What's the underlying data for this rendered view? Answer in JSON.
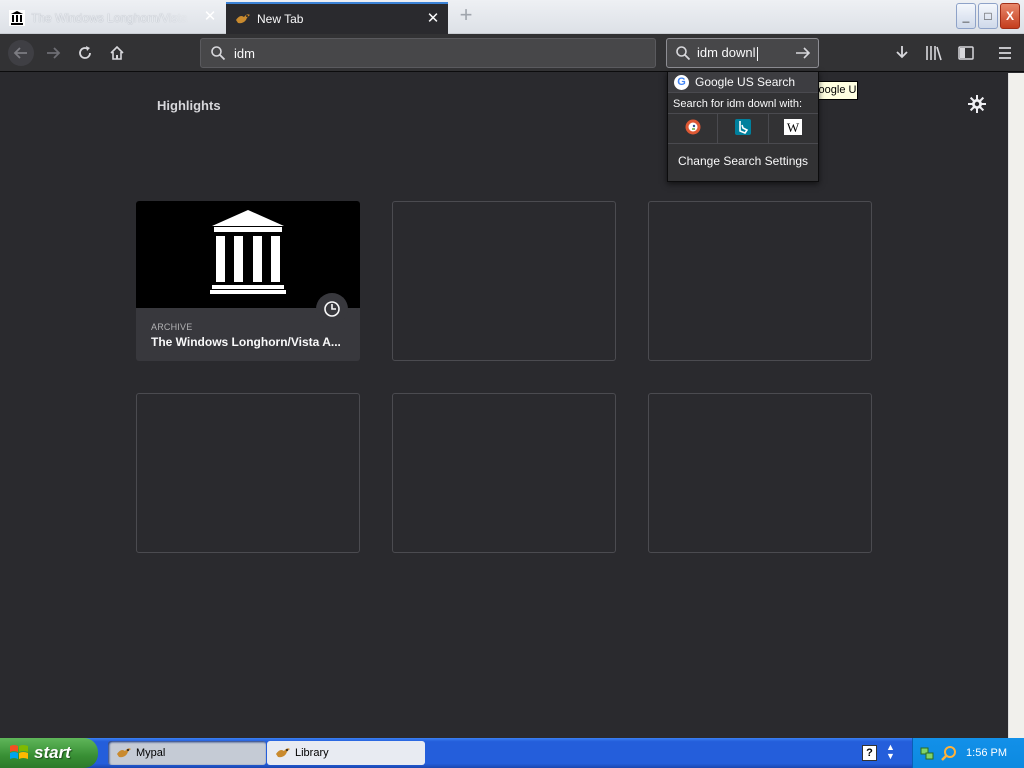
{
  "tabs": [
    {
      "label": "The Windows Longhorn/Vista Archive",
      "state": "inactive",
      "icon": "archive-building-icon"
    },
    {
      "label": "New Tab",
      "state": "active",
      "icon": "mypal-bird-icon"
    }
  ],
  "window_controls": {
    "minimize": "_",
    "maximize": "□",
    "close": "X"
  },
  "toolbar": {
    "url_value": "idm",
    "search_value": "idm downl"
  },
  "search_popup": {
    "engine": "Google US Search",
    "search_with_label": "Search for idm downl with:",
    "alternatives": [
      "duckduckgo-icon",
      "bing-icon",
      "wikipedia-icon"
    ],
    "settings_label": "Change Search Settings",
    "tooltip": "Google US"
  },
  "content": {
    "section_title": "Highlights",
    "highlight": {
      "source": "ARCHIVE",
      "title": "The Windows Longhorn/Vista A..."
    }
  },
  "taskbar": {
    "start_label": "start",
    "tasks": [
      "Mypal",
      "Library"
    ],
    "clock": "1:56 PM"
  },
  "colors": {
    "content_bg": "#2a2a2e",
    "toolbar_bg": "#323234",
    "card_border": "#4b4b50",
    "taskbar_blue": "#245edb",
    "start_green": "#388f34"
  }
}
